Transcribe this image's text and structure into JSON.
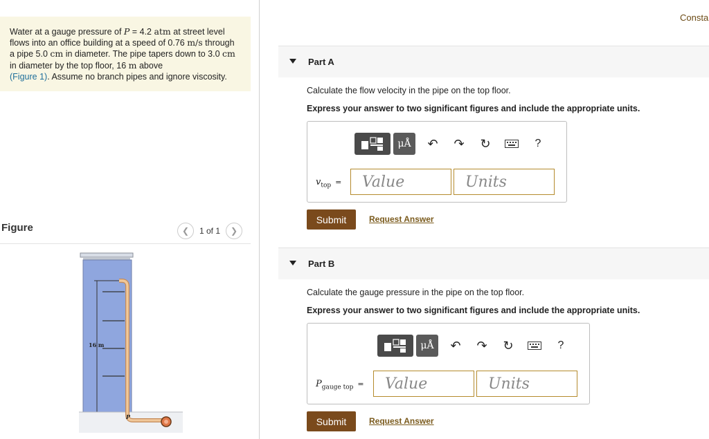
{
  "problem": {
    "seg1": "Water at a gauge pressure of ",
    "var_P": "P",
    "seg2": " = 4.2 ",
    "unit_atm": "atm",
    "seg3": " at street level flows into an office building at a speed of 0.76 ",
    "unit_ms": "m/s",
    "seg4": " through a pipe 5.0 ",
    "unit_cm1": "cm",
    "seg5": " in diameter. The pipe tapers down to 3.0 ",
    "unit_cm2": "cm",
    "seg6": " in diameter by the top floor, 16 ",
    "unit_m": "m",
    "seg7": " above",
    "fig_link": "(Figure 1)",
    "seg8": ". Assume no branch pipes and ignore viscosity."
  },
  "figure": {
    "label": "Figure",
    "pager": "1 of 1",
    "prev_icon": "chevron-left-icon",
    "next_icon": "chevron-right-icon",
    "height_label": "16 m",
    "pressure_label": "P"
  },
  "header_right": "Consta",
  "partA": {
    "title": "Part A",
    "question": "Calculate the flow velocity in the pipe on the top floor.",
    "instruction": "Express your answer to two significant figures and include the appropriate units.",
    "var": "v",
    "var_sub": "top",
    "eq": "=",
    "value_placeholder": "Value",
    "units_placeholder": "Units",
    "submit": "Submit",
    "request": "Request Answer"
  },
  "partB": {
    "title": "Part B",
    "question": "Calculate the gauge pressure in the pipe on the top floor.",
    "instruction": "Express your answer to two significant figures and include the appropriate units.",
    "var": "P",
    "var_sub": "gauge top",
    "eq": "=",
    "value_placeholder": "Value",
    "units_placeholder": "Units",
    "submit": "Submit",
    "request": "Request Answer"
  },
  "toolbar": {
    "mu_label": "μÅ",
    "help_label": "?",
    "icons": [
      "template-icon",
      "units-icon",
      "undo-icon",
      "redo-icon",
      "reset-icon",
      "keyboard-icon",
      "help-icon"
    ]
  },
  "colors": {
    "submit_bg": "#7a4a1c",
    "field_border": "#b48a2c",
    "link": "#1f6f9b",
    "problem_bg": "#f9f6e3",
    "water": "#8fa6de",
    "pipe": "#e8b47a"
  }
}
